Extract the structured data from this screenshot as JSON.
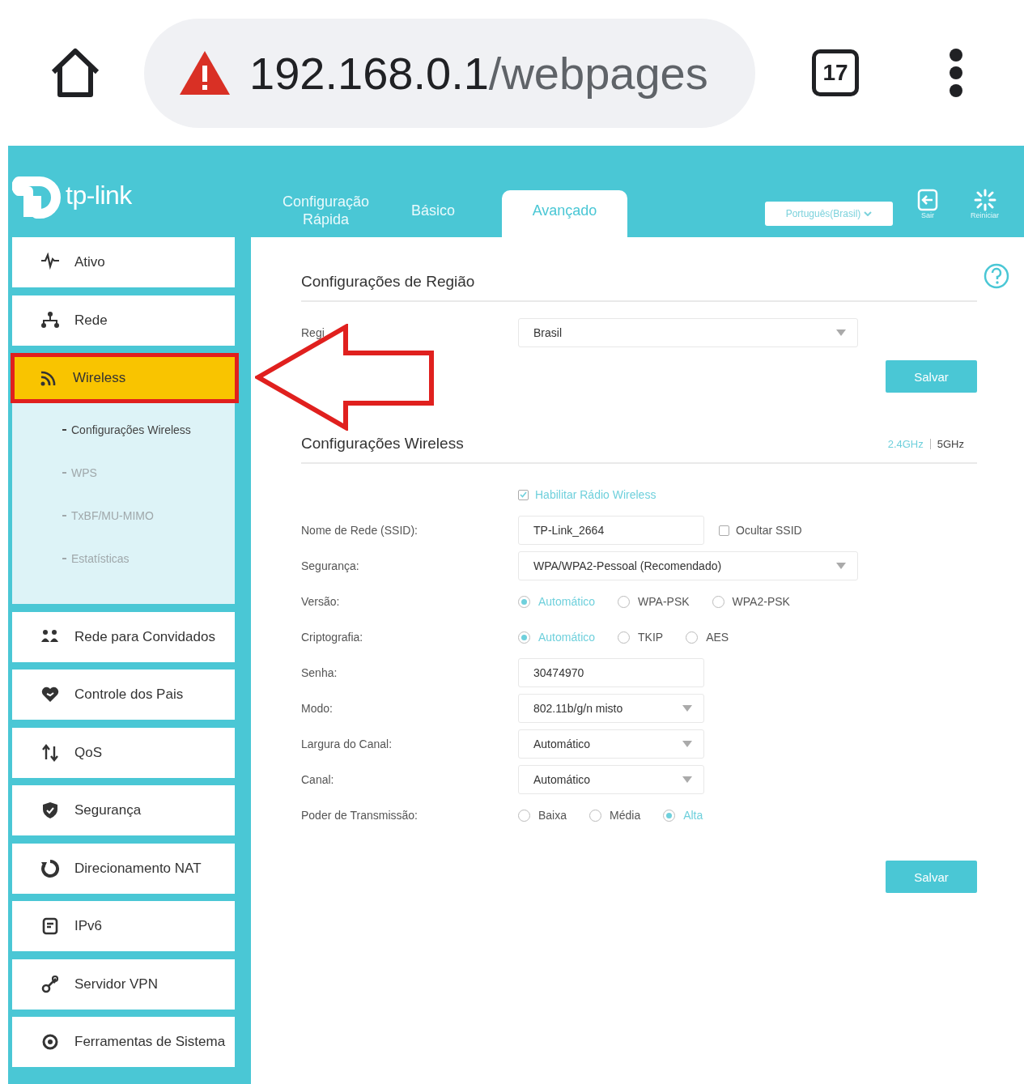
{
  "browser": {
    "url_host": "192.168.0.1",
    "url_path": "/webpages",
    "tab_count": "17"
  },
  "header": {
    "logo": "tp-link",
    "tabs": [
      {
        "label": "Configuração Rápida",
        "selected": false
      },
      {
        "label": "Básico",
        "selected": false
      },
      {
        "label": "Avançado",
        "selected": true
      }
    ],
    "language": "Português(Brasil)",
    "actions": [
      {
        "kind": "logout",
        "label": "Sair"
      },
      {
        "kind": "reboot",
        "label": "Reiniciar"
      }
    ]
  },
  "sidebar": {
    "items": [
      {
        "label": "Ativo",
        "selected": false,
        "highlighted": false
      },
      {
        "label": "Rede",
        "selected": false,
        "highlighted": false
      },
      {
        "label": "Wireless",
        "selected": true,
        "highlighted": true,
        "expanded": true,
        "children": [
          {
            "label": "Configurações Wireless",
            "selected": true
          },
          {
            "label": "WPS",
            "selected": false
          },
          {
            "label": "TxBF/MU-MIMO",
            "selected": false
          },
          {
            "label": "Estatísticas",
            "selected": false
          }
        ]
      },
      {
        "label": "Rede para Convidados",
        "selected": false,
        "highlighted": false
      },
      {
        "label": "Controle dos Pais",
        "selected": false,
        "highlighted": false
      },
      {
        "label": "QoS",
        "selected": false,
        "highlighted": false
      },
      {
        "label": "Segurança",
        "selected": false,
        "highlighted": false
      },
      {
        "label": "Direcionamento NAT",
        "selected": false,
        "highlighted": false
      },
      {
        "label": "IPv6",
        "selected": false,
        "highlighted": false
      },
      {
        "label": "Servidor VPN",
        "selected": false,
        "highlighted": false
      },
      {
        "label": "Ferramentas de Sistema",
        "selected": false,
        "highlighted": false
      }
    ]
  },
  "region_section": {
    "title": "Configurações de Região",
    "field_label": "Regi",
    "field_value": "Brasil",
    "button": "Salvar"
  },
  "wireless_section": {
    "title": "Configurações Wireless",
    "bands": [
      {
        "label": "2.4GHz",
        "selected": true
      },
      {
        "label": "5GHz",
        "selected": false
      }
    ],
    "enable": {
      "label": "Habilitar Rádio Wireless",
      "checked": true
    },
    "rows": [
      {
        "kind": "text",
        "label": "Nome de Rede (SSID):",
        "value": "TP-Link_2664",
        "checkbox": {
          "label": "Ocultar SSID",
          "checked": false
        }
      },
      {
        "kind": "wide-select",
        "label": "Segurança:",
        "value": "WPA/WPA2-Pessoal (Recomendado)"
      },
      {
        "kind": "radio",
        "label": "Versão:",
        "options": [
          {
            "label": "Automático",
            "selected": true
          },
          {
            "label": "WPA-PSK",
            "selected": false
          },
          {
            "label": "WPA2-PSK",
            "selected": false
          }
        ]
      },
      {
        "kind": "radio",
        "label": "Criptografia:",
        "options": [
          {
            "label": "Automático",
            "selected": true
          },
          {
            "label": "TKIP",
            "selected": false
          },
          {
            "label": "AES",
            "selected": false
          }
        ]
      },
      {
        "kind": "text",
        "label": "Senha:",
        "value": "30474970"
      },
      {
        "kind": "select",
        "label": "Modo:",
        "value": "802.11b/g/n misto"
      },
      {
        "kind": "select",
        "label": "Largura do Canal:",
        "value": "Automático"
      },
      {
        "kind": "select",
        "label": "Canal:",
        "value": "Automático"
      },
      {
        "kind": "radio",
        "label": "Poder de Transmissão:",
        "options": [
          {
            "label": "Baixa",
            "selected": false
          },
          {
            "label": "Média",
            "selected": false
          },
          {
            "label": "Alta",
            "selected": true
          }
        ]
      }
    ],
    "button": "Salvar"
  }
}
